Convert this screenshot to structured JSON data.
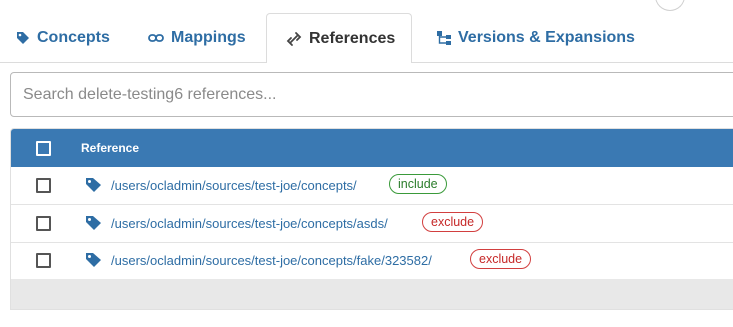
{
  "tabs": [
    {
      "label": "Concepts",
      "icon": "tag-icon",
      "active": false
    },
    {
      "label": "Mappings",
      "icon": "link-icon",
      "active": false
    },
    {
      "label": "References",
      "icon": "broken-link-icon",
      "active": true
    },
    {
      "label": "Versions & Expansions",
      "icon": "hierarchy-icon",
      "active": false
    }
  ],
  "search": {
    "placeholder": "Search delete-testing6 references..."
  },
  "table": {
    "header": {
      "reference": "Reference"
    },
    "rows": [
      {
        "reference": "/users/ocladmin/sources/test-joe/concepts/",
        "type": "include"
      },
      {
        "reference": "/users/ocladmin/sources/test-joe/concepts/asds/",
        "type": "exclude"
      },
      {
        "reference": "/users/ocladmin/sources/test-joe/concepts/fake/323582/",
        "type": "exclude"
      }
    ]
  },
  "colors": {
    "primary": "#2e6da4",
    "header_bg": "#3a79b3",
    "include": "#2b7d2b",
    "exclude": "#c62828"
  }
}
